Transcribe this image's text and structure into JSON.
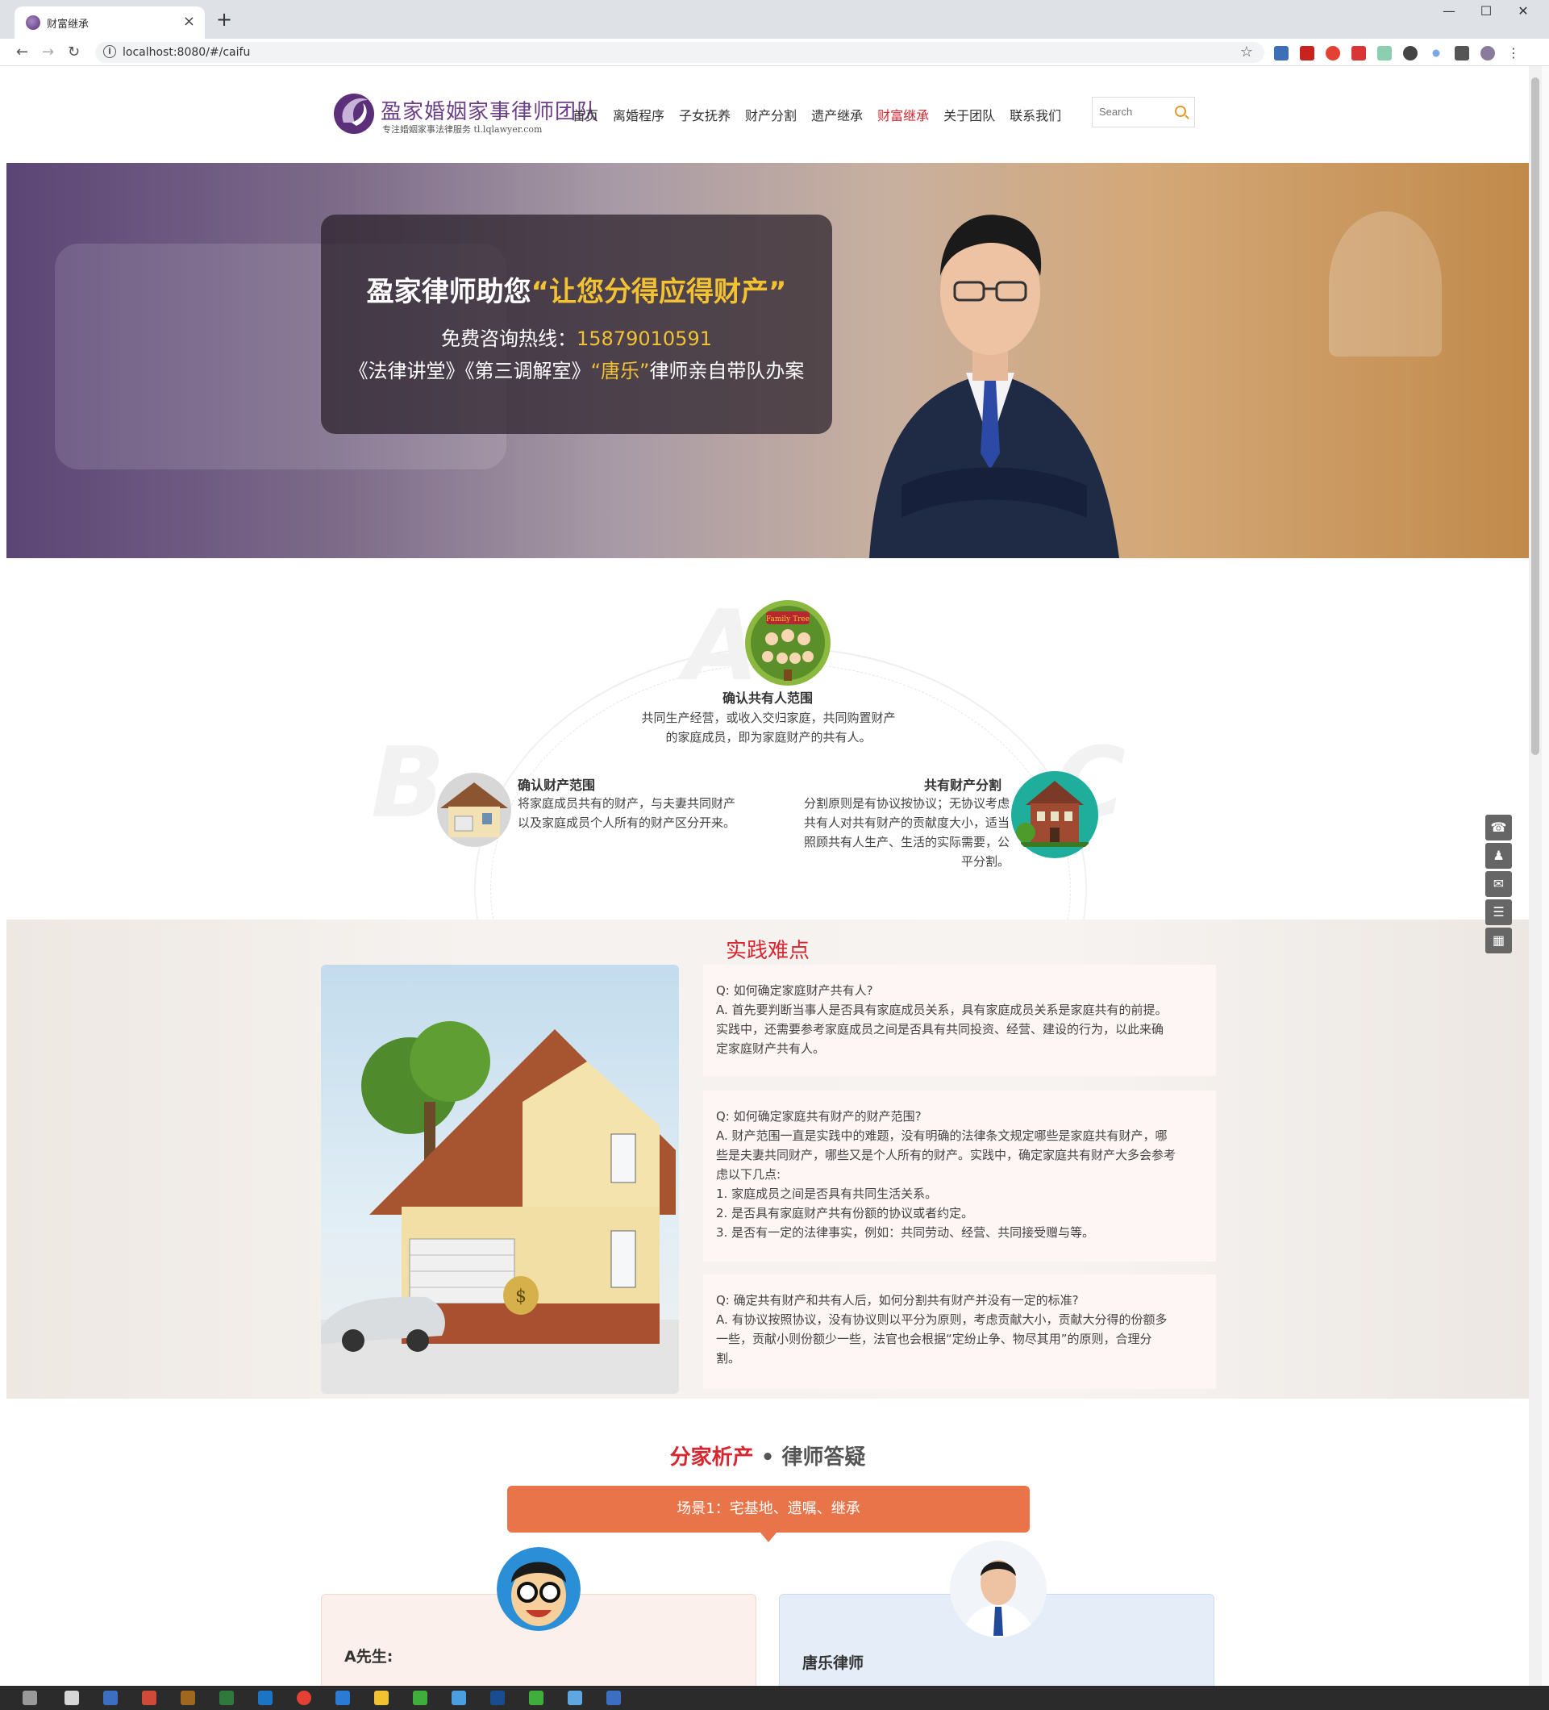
{
  "browser": {
    "tab_title": "财富继承",
    "url": "localhost:8080/#/caifu",
    "close_glyph": "×",
    "new_tab_glyph": "+",
    "minimize_glyph": "—",
    "maximize_glyph": "☐",
    "close_window_glyph": "✕",
    "back_glyph": "←",
    "forward_glyph": "→",
    "reload_glyph": "↻",
    "info_glyph": "i",
    "star_glyph": "☆",
    "menu_glyph": "⋮"
  },
  "header": {
    "logo_text": "盈家婚姻家事律师团队",
    "logo_sub": "专注婚姻家事法律服务 tl.lqlawyer.com",
    "nav": [
      "首页",
      "离婚程序",
      "子女抚养",
      "财产分割",
      "遗产继承",
      "财富继承",
      "关于团队",
      "联系我们"
    ],
    "active_nav": "财富继承",
    "search_placeholder": "Search"
  },
  "banner": {
    "headline_prefix": "盈家律师助您",
    "headline_highlight": "“让您分得应得财产”",
    "hotline_label": "免费咨询热线：",
    "hotline_number": "15879010591",
    "tv_prefix": "《法律讲堂》《第三调解室》",
    "tv_highlight": "“唐乐”",
    "tv_suffix": "律师亲自带队办案"
  },
  "scope": {
    "letters": [
      "A",
      "B",
      "C"
    ],
    "tree_label": "Family Tree",
    "item_a_title": "确认共有人范围",
    "item_a_desc_1": "共同生产经营，或收入交归家庭，共同购置财产",
    "item_a_desc_2": "的家庭成员，即为家庭财产的共有人。",
    "item_b_title": "确认财产范围",
    "item_b_desc_1": "将家庭成员共有的财产，与夫妻共同财产",
    "item_b_desc_2": "以及家庭成员个人所有的财产区分开来。",
    "item_c_title": "共有财产分割",
    "item_c_desc_1": "分割原则是有协议按协议；无协议考虑",
    "item_c_desc_2": "共有人对共有财产的贡献度大小，适当",
    "item_c_desc_3": "照顾共有人生产、生活的实际需要，公",
    "item_c_desc_4": "平分割。"
  },
  "practice": {
    "title": "实践难点",
    "money_bag_glyph": "$",
    "qa": [
      {
        "q": "Q: 如何确定家庭财产共有人?",
        "a1": "A. 首先要判断当事人是否具有家庭成员关系，具有家庭成员关系是家庭共有的前提。",
        "a2": "实践中，还需要参考家庭成员之间是否具有共同投资、经营、建设的行为，以此来确",
        "a3": "定家庭财产共有人。"
      },
      {
        "q": "Q: 如何确定家庭共有财产的财产范围?",
        "a1": "A. 财产范围一直是实践中的难题，没有明确的法律条文规定哪些是家庭共有财产，哪",
        "a2": "些是夫妻共同财产，哪些又是个人所有的财产。实践中，确定家庭共有财产大多会参考",
        "a3": "虑以下几点:",
        "p1": "1. 家庭成员之间是否具有共同生活关系。",
        "p2": "2. 是否具有家庭财产共有份额的协议或者约定。",
        "p3": "3. 是否有一定的法律事实，例如：共同劳动、经营、共同接受赠与等。"
      },
      {
        "q": "Q: 确定共有财产和共有人后，如何分割共有财产并没有一定的标准?",
        "a1": "A. 有协议按照协议，没有协议则以平分为原则，考虑贡献大小，贡献大分得的份额多",
        "a2": "一些，贡献小则份额少一些，法官也会根据“定纷止争、物尽其用”的原则，合理分",
        "a3": "割。"
      }
    ]
  },
  "consult": {
    "title_red": "分家析产",
    "title_rest": " • 律师答疑",
    "scene": "场景1：宅基地、遗嘱、继承",
    "left_name": "A先生:",
    "right_name": "唐乐律师"
  },
  "side_tools": [
    "phone-icon",
    "qq-icon",
    "wechat-icon",
    "message-icon",
    "qrcode-icon"
  ],
  "side_tool_glyphs": [
    "☎",
    "♟",
    "✉",
    "☰",
    "▦"
  ],
  "colors": {
    "accent_red": "#d8262f",
    "highlight_yellow": "#f2c233",
    "brand_purple": "#6b3f88",
    "scene_orange": "#e9744a"
  }
}
